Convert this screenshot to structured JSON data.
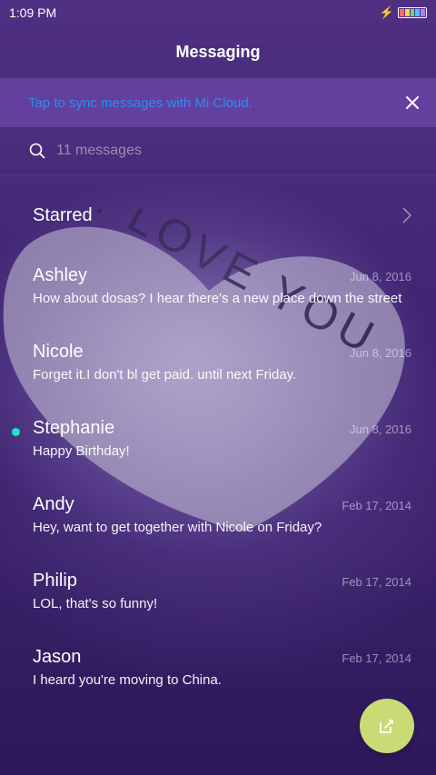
{
  "status_bar": {
    "time": "1:09 PM",
    "battery_colors": [
      "#ff6a6a",
      "#ffd24a",
      "#5ee07a",
      "#4ac2ff",
      "#b47cff"
    ]
  },
  "header": {
    "title": "Messaging"
  },
  "sync_banner": {
    "text": "Tap to sync messages with Mi Cloud."
  },
  "search": {
    "placeholder": "11 messages"
  },
  "starred": {
    "label": "Starred"
  },
  "conversations": [
    {
      "name": "Ashley",
      "date": "Jun 8, 2016",
      "preview": "How about dosas? I hear there's a new place down the street",
      "unread": false
    },
    {
      "name": "Nicole",
      "date": "Jun 8, 2016",
      "preview": "Forget it.I don't bl get paid. until next Friday.",
      "unread": false
    },
    {
      "name": "Stephanie",
      "date": "Jun 8, 2016",
      "preview": "Happy Birthday!",
      "unread": true
    },
    {
      "name": "Andy",
      "date": "Feb 17, 2014",
      "preview": "Hey, want to get together with Nicole on Friday?",
      "unread": false
    },
    {
      "name": "Philip",
      "date": "Feb 17, 2014",
      "preview": "LOL, that's so funny!",
      "unread": false
    },
    {
      "name": "Jason",
      "date": "Feb 17, 2014",
      "preview": "I heard you're moving to China.",
      "unread": false
    }
  ],
  "wallpaper": {
    "text": "I LOVE YOU"
  },
  "colors": {
    "accent_link": "#2f8cf0",
    "unread_dot": "#19e6c0",
    "fab": "#c9db74"
  }
}
